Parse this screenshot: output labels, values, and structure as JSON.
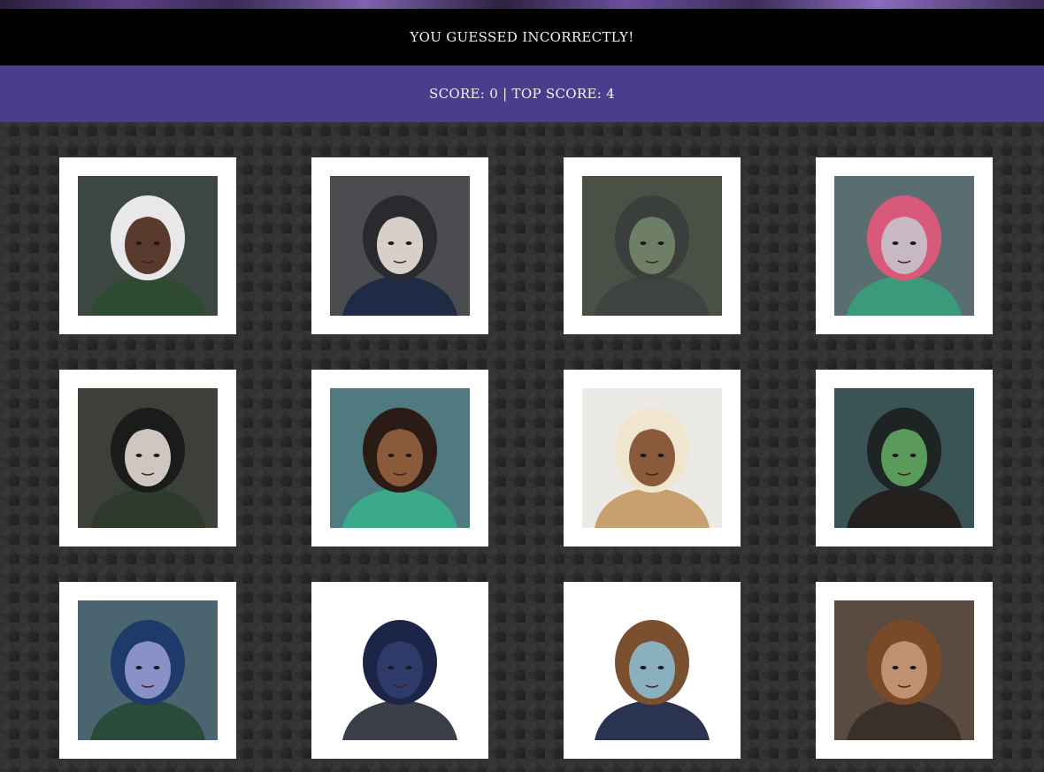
{
  "header": {
    "message": "YOU GUESSED INCORRECTLY!",
    "score_text": "SCORE: 0 | TOP SCORE: 4"
  },
  "cards": [
    {
      "icon": "portrait-white-haired-elder",
      "bg": "#3b4740",
      "skin": "#5a3a2c",
      "hair": "#e8e8ea",
      "cloth": "#2f4a32"
    },
    {
      "icon": "portrait-braided-dark-hair",
      "bg": "#4a4c50",
      "skin": "#d8d0c8",
      "hair": "#2a2a2e",
      "cloth": "#1f2a44"
    },
    {
      "icon": "portrait-hooded-goblin",
      "bg": "#4a5046",
      "skin": "#6f7f66",
      "hair": "#3a3e3c",
      "cloth": "#3e4240"
    },
    {
      "icon": "portrait-pink-haired-firbolg",
      "bg": "#5a6e72",
      "skin": "#c8b8c4",
      "hair": "#d85a7a",
      "cloth": "#3a9a7a"
    },
    {
      "icon": "portrait-horned-dark-hair",
      "bg": "#3c4038",
      "skin": "#cfc6c0",
      "hair": "#1a1c1c",
      "cloth": "#2e3a2e"
    },
    {
      "icon": "portrait-topknot-monk",
      "bg": "#4e7a80",
      "skin": "#8a5a3a",
      "hair": "#2a1c14",
      "cloth": "#3aaa8a"
    },
    {
      "icon": "portrait-flower-crown-blonde",
      "bg": "#eceae6",
      "skin": "#8a5a3a",
      "hair": "#f0e6d0",
      "cloth": "#c8a070"
    },
    {
      "icon": "portrait-green-half-orc",
      "bg": "#3a5456",
      "skin": "#5a9a5a",
      "hair": "#1e2424",
      "cloth": "#24201e"
    },
    {
      "icon": "portrait-blue-tiefling",
      "bg": "#4a6470",
      "skin": "#8a90c8",
      "hair": "#1e3a6a",
      "cloth": "#2a4a3a"
    },
    {
      "icon": "portrait-hooded-crow",
      "bg": "#ffffff",
      "skin": "#2e3a6a",
      "hair": "#1c2448",
      "cloth": "#3a3e48"
    },
    {
      "icon": "portrait-bearded-gnome",
      "bg": "#ffffff",
      "skin": "#8ab0c0",
      "hair": "#7a5030",
      "cloth": "#2a3450"
    },
    {
      "icon": "portrait-scarred-brown-hair",
      "bg": "#5a4a40",
      "skin": "#c09070",
      "hair": "#7a4a28",
      "cloth": "#3a3028"
    }
  ]
}
